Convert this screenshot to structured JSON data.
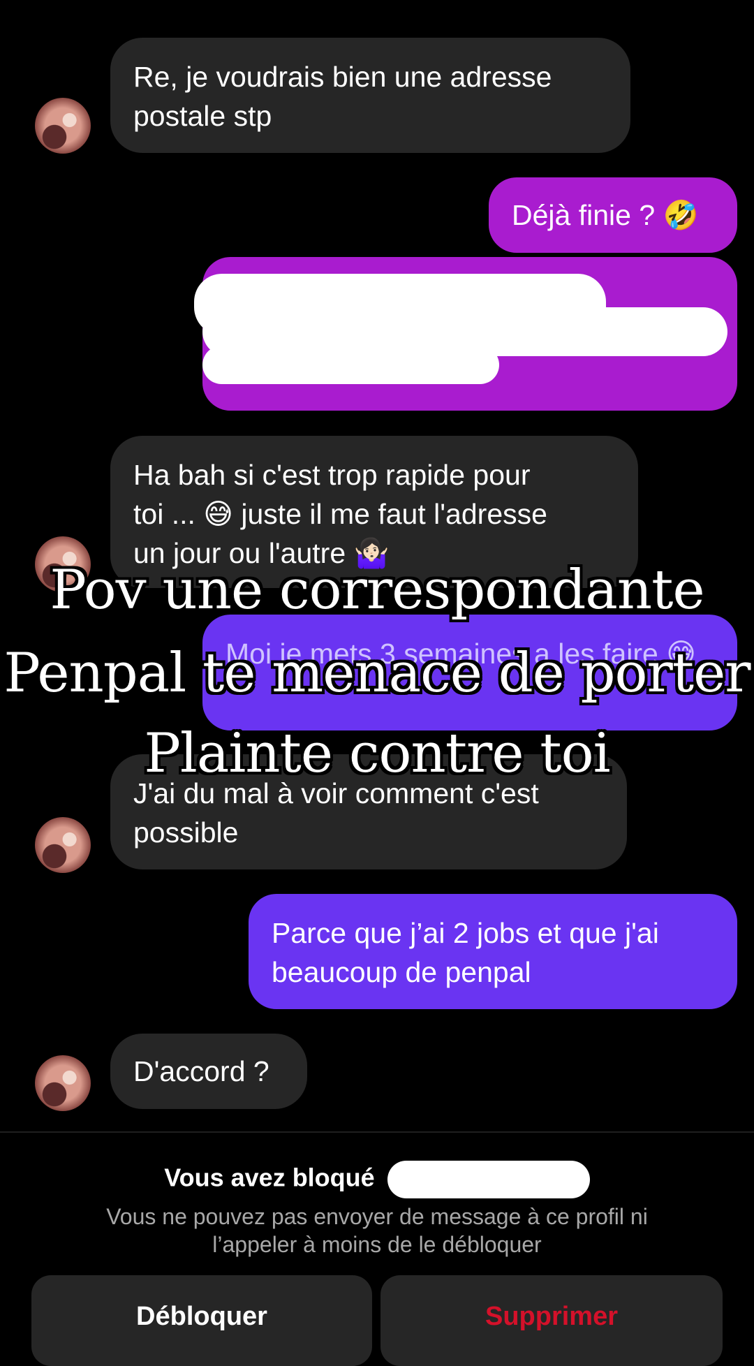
{
  "messages": [
    {
      "from": "them",
      "text_lines": [
        "Re, je voudrais bien une adresse",
        "postale stp"
      ]
    },
    {
      "from": "me",
      "text": "Déjà finie ? 🤣"
    },
    {
      "from": "me",
      "redacted": true
    },
    {
      "from": "them",
      "text_lines": [
        "Ha bah si c'est trop rapide pour",
        "toi ... 😅 juste il me faut l'adresse",
        "un jour ou l'autre 🤷🏻‍♀️"
      ]
    },
    {
      "from": "me",
      "text": "Moi je mets 3 semaines a les faire 😅"
    },
    {
      "from": "them",
      "text_lines": [
        "J'ai du mal à voir comment c'est",
        "possible"
      ]
    },
    {
      "from": "me",
      "text_lines": [
        "Parce que j’ai 2 jobs et que j'ai",
        "beaucoup de penpal"
      ]
    },
    {
      "from": "them",
      "text": "D'accord ?"
    }
  ],
  "overlay_caption": {
    "lines": [
      "Pov une correspondante",
      "Penpal te menace de porter",
      "Plainte contre toi"
    ]
  },
  "blocked_banner": {
    "title": "Vous avez bloqué",
    "subtitle_lines": [
      "Vous ne pouvez pas envoyer de message à ce profil ni",
      "l’appeler à moins de le débloquer"
    ]
  },
  "actions": {
    "unblock_label": "Débloquer",
    "delete_label": "Supprimer"
  },
  "colors": {
    "received_bubble": "#262626",
    "sent_pink": "#a91ccf",
    "sent_purple": "#6a34f2",
    "delete_red": "#d4112a"
  }
}
